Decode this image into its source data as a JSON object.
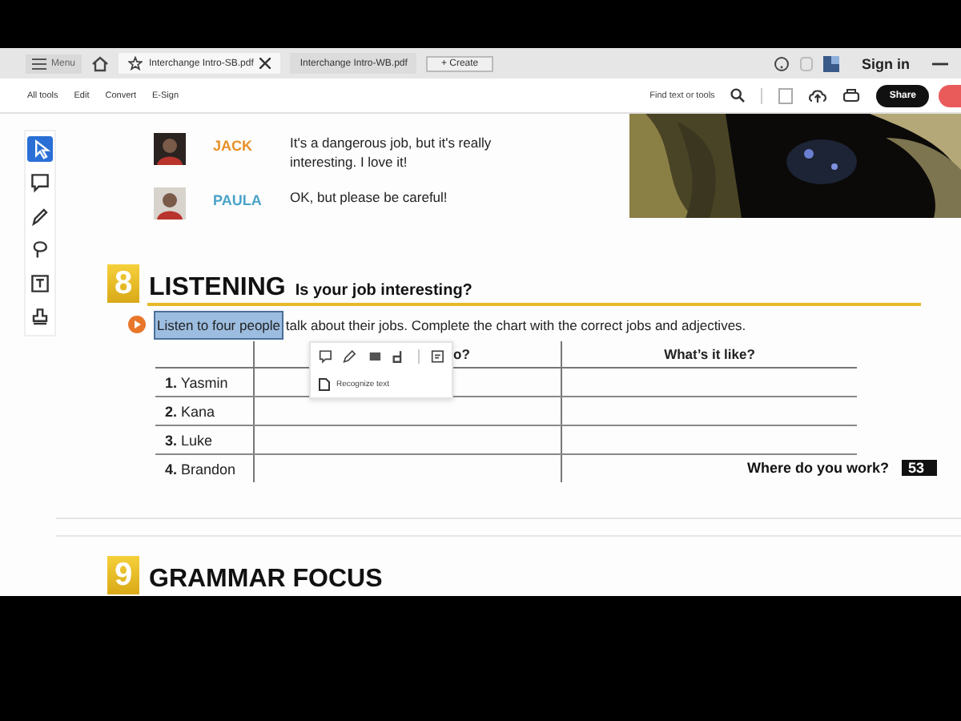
{
  "tabbar": {
    "menu": "Menu",
    "tabs": [
      {
        "label": "Interchange Intro-SB.pdf",
        "selected": true
      },
      {
        "label": "Interchange Intro-WB.pdf",
        "selected": false
      }
    ],
    "create": "+ Create",
    "sign_in": "Sign in"
  },
  "toolbar": {
    "items": [
      "All tools",
      "Edit",
      "Convert",
      "E-Sign"
    ],
    "search_placeholder": "Find text or tools",
    "share": "Share"
  },
  "tool_rail": [
    {
      "kind": "select",
      "selected": true
    },
    {
      "kind": "comment",
      "selected": false
    },
    {
      "kind": "pen",
      "selected": false
    },
    {
      "kind": "lasso",
      "selected": false
    },
    {
      "kind": "textbox",
      "selected": false
    },
    {
      "kind": "stamp",
      "selected": false
    }
  ],
  "dialogue": [
    {
      "name": "JACK",
      "color": "#e8902a",
      "lines": [
        "It's a dangerous job, but it's really",
        "interesting. I love it!"
      ]
    },
    {
      "name": "PAULA",
      "color": "#4aa3c9",
      "lines": [
        "OK, but please be careful!"
      ]
    }
  ],
  "section": {
    "number": "8",
    "title": "LISTENING",
    "subtitle": "Is your job interesting?",
    "selected_text": "Listen to four people",
    "rest_text": " talk about their jobs. Complete the chart with the correct jobs and adjectives."
  },
  "popup": {
    "menu_item": "Recognize text"
  },
  "table": {
    "column_headers": [
      "o?",
      "What’s it like?"
    ],
    "rows": [
      {
        "number": "1.",
        "name": "Yasmin"
      },
      {
        "number": "2.",
        "name": "Kana"
      },
      {
        "number": "3.",
        "name": "Luke"
      },
      {
        "number": "4.",
        "name": "Brandon"
      }
    ]
  },
  "footer": {
    "text": "Where do you work?",
    "page": "53"
  },
  "next_section": {
    "number": "9",
    "title": "GRAMMAR FOCUS"
  }
}
